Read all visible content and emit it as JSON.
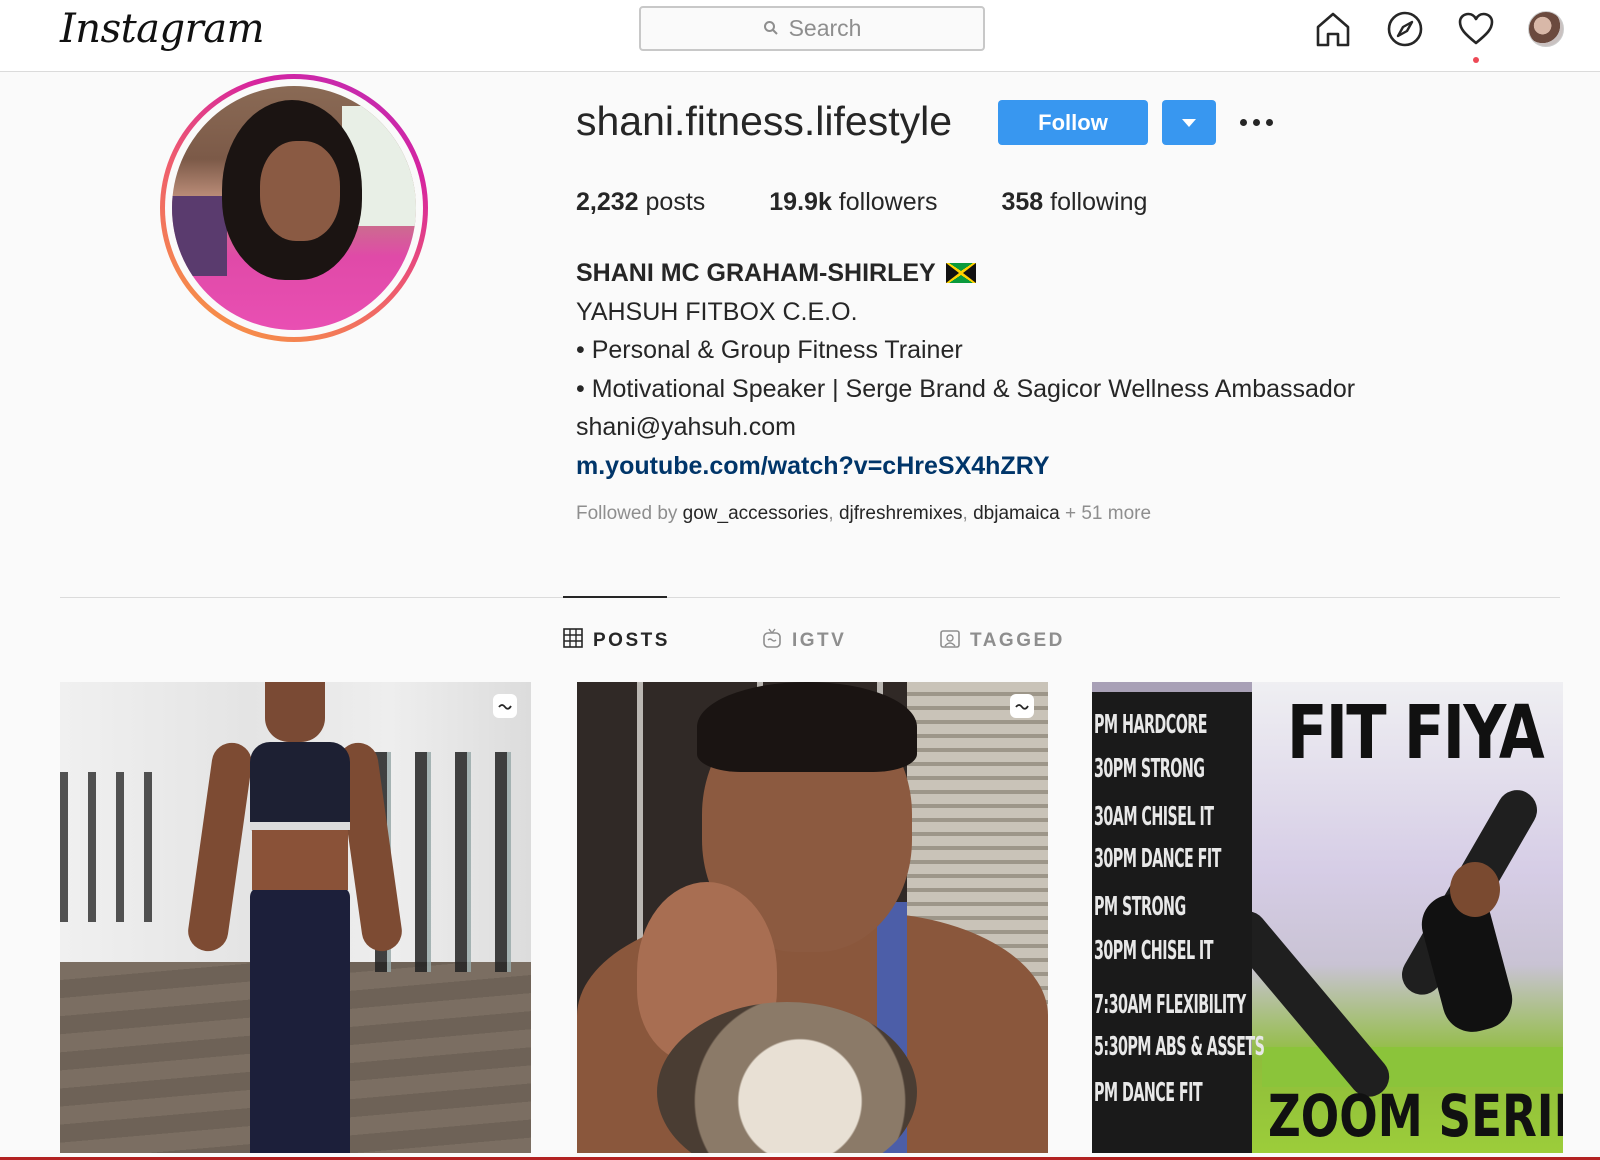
{
  "nav": {
    "logo": "Instagram",
    "search_placeholder": "Search",
    "icons": [
      "home-icon",
      "explore-compass-icon",
      "activity-heart-icon",
      "profile-avatar"
    ],
    "notification_dot_color": "#ed4956"
  },
  "profile": {
    "username": "shani.fitness.lifestyle",
    "follow_label": "Follow",
    "accent_color": "#3897f0",
    "stats": {
      "posts_count": "2,232",
      "posts_label": "posts",
      "followers_count": "19.9k",
      "followers_label": "followers",
      "following_count": "358",
      "following_label": "following"
    },
    "bio": {
      "full_name": "SHANI MC GRAHAM-SHIRLEY",
      "flag": "jamaica-flag",
      "line1": "YAHSUH FITBOX C.E.O.",
      "line2": "• Personal & Group Fitness Trainer",
      "line3": "• Motivational Speaker | Serge Brand & Sagicor Wellness Ambassador",
      "email": "shani@yahsuh.com",
      "link": "m.youtube.com/watch?v=cHreSX4hZRY"
    },
    "followed_by": {
      "prefix": "Followed by",
      "users": [
        "gow_accessories",
        "djfreshremixes",
        "dbjamaica"
      ],
      "more": "+ 51 more"
    }
  },
  "tabs": [
    {
      "label": "POSTS",
      "icon": "grid-icon",
      "active": true
    },
    {
      "label": "IGTV",
      "icon": "igtv-icon",
      "active": false
    },
    {
      "label": "TAGGED",
      "icon": "tagged-icon",
      "active": false
    }
  ],
  "posts": [
    {
      "type": "igtv"
    },
    {
      "type": "igtv"
    },
    {
      "type": "image",
      "schedule": [
        "PM HARDCORE",
        "30PM STRONG",
        "30AM CHISEL IT",
        "30PM DANCE FIT",
        "PM STRONG",
        "30PM CHISEL IT",
        "7:30AM FLEXIBILITY",
        "5:30PM ABS & ASSETS",
        "PM DANCE FIT"
      ],
      "headline": "FIT FIYA",
      "footer": "ZOOM SERIE"
    }
  ]
}
